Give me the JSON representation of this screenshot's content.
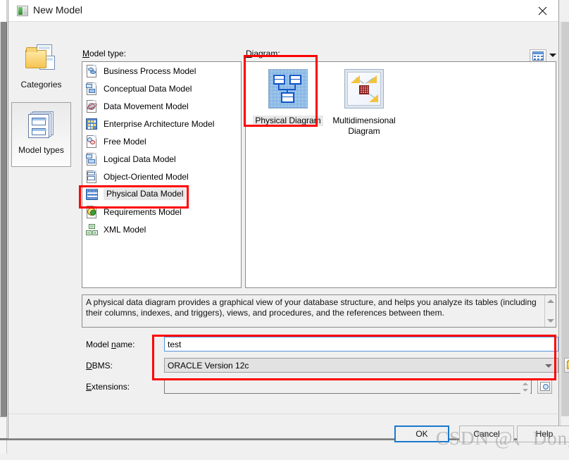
{
  "window": {
    "title": "New Model",
    "close_icon": "close-icon"
  },
  "sidebar": {
    "items": [
      {
        "label": "Categories",
        "icon": "categories-icon",
        "selected": false
      },
      {
        "label": "Model types",
        "icon": "model-types-icon",
        "selected": true
      }
    ]
  },
  "model_type": {
    "label": "Model type:",
    "label_mnemonic": "M",
    "items": [
      {
        "label": "Business Process Model",
        "icon": "business-process-model-icon",
        "selected": false
      },
      {
        "label": "Conceptual Data Model",
        "icon": "conceptual-data-model-icon",
        "selected": false
      },
      {
        "label": "Data Movement Model",
        "icon": "data-movement-model-icon",
        "selected": false
      },
      {
        "label": "Enterprise Architecture Model",
        "icon": "enterprise-architecture-model-icon",
        "selected": false
      },
      {
        "label": "Free Model",
        "icon": "free-model-icon",
        "selected": false
      },
      {
        "label": "Logical Data Model",
        "icon": "logical-data-model-icon",
        "selected": false
      },
      {
        "label": "Object-Oriented Model",
        "icon": "object-oriented-model-icon",
        "selected": false
      },
      {
        "label": "Physical Data Model",
        "icon": "physical-data-model-icon",
        "selected": true
      },
      {
        "label": "Requirements Model",
        "icon": "requirements-model-icon",
        "selected": false
      },
      {
        "label": "XML Model",
        "icon": "xml-model-icon",
        "selected": false
      }
    ]
  },
  "diagram": {
    "label": "Diagram:",
    "label_mnemonic": "D",
    "view_mode_button": {
      "icon": "list-view-icon",
      "dropdown_icon": "chevron-down-icon"
    },
    "items": [
      {
        "label": "Physical Diagram",
        "icon": "physical-diagram-icon",
        "selected": true
      },
      {
        "label": "Multidimensional Diagram",
        "icon": "multidimensional-diagram-icon",
        "selected": false
      }
    ]
  },
  "description": {
    "text": "A physical data diagram provides a graphical view of your database structure, and helps you analyze its tables (including their columns, indexes, and triggers), views, and procedures, and the references between them.",
    "scroll_up_icon": "scroll-up-icon",
    "scroll_down_icon": "scroll-down-icon"
  },
  "form": {
    "model_name": {
      "label": "Model name:",
      "value": "test",
      "placeholder": ""
    },
    "dbms": {
      "label": "DBMS:",
      "value": "ORACLE Version 12c",
      "dropdown_icon": "chevron-down-icon",
      "browse_button_icon": "folder-icon",
      "import_button_icon": "import-arrow-icon"
    },
    "extensions": {
      "label": "Extensions:",
      "value": "",
      "spin_up_icon": "spin-up-icon",
      "spin_down_icon": "spin-down-icon",
      "select_button_icon": "magnifier-icon"
    }
  },
  "buttons": {
    "ok": "OK",
    "cancel": "Cancel",
    "help": "Help"
  },
  "watermark": {
    "text": "CSDN @、Dong"
  },
  "colors": {
    "accent": "#1878d0",
    "annotation": "#ff0000",
    "selection": "#e8e8e8",
    "dialog_bg": "#f0f0f0"
  }
}
